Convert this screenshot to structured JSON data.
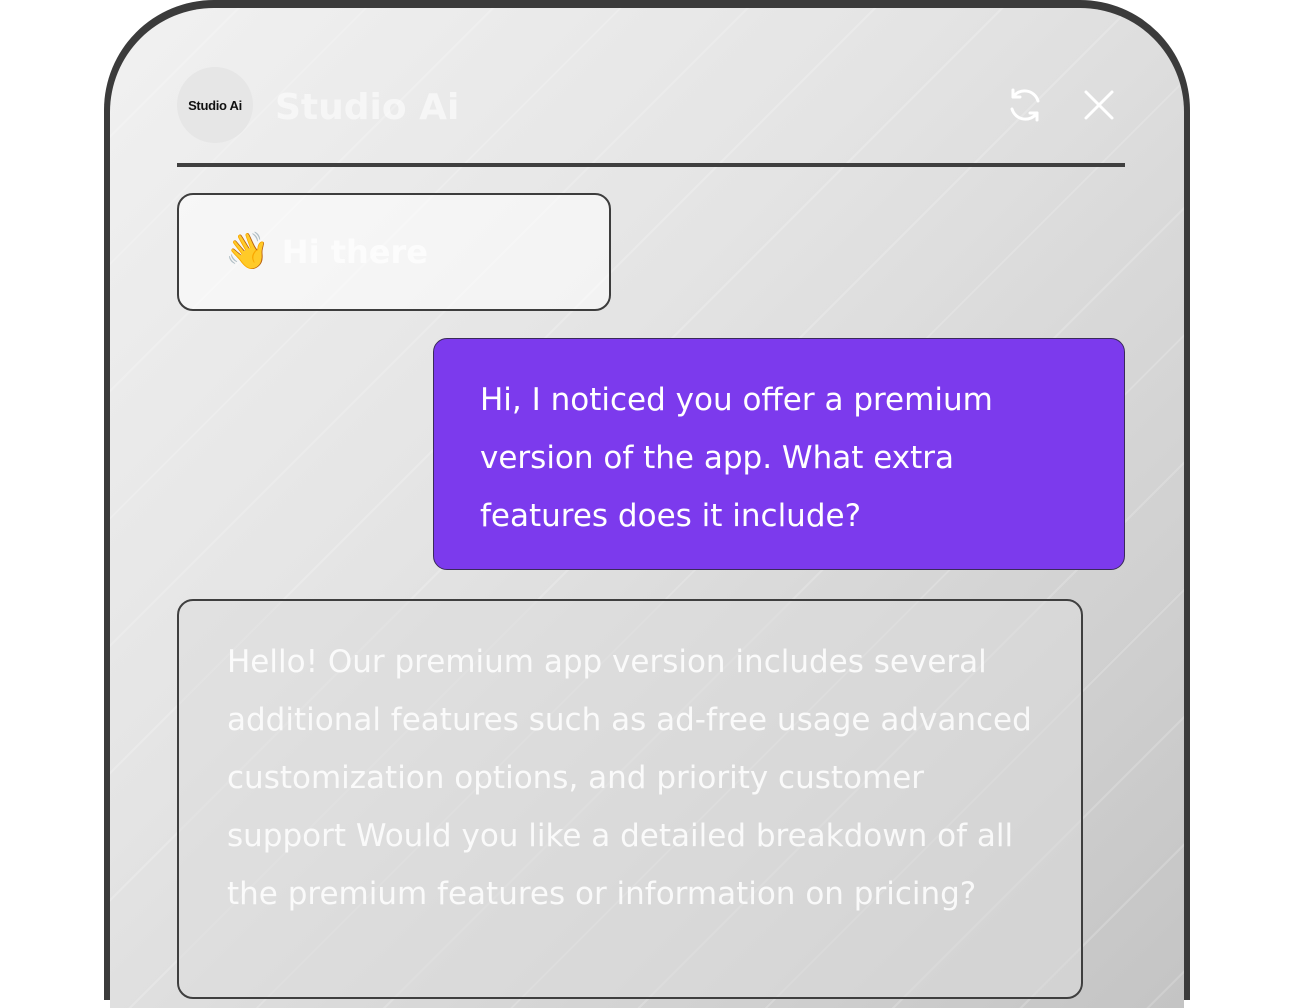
{
  "header": {
    "avatar_text": "Studio Ai",
    "title": "Studio Ai",
    "refresh_icon": "refresh-icon",
    "close_icon": "close-icon"
  },
  "messages": {
    "greeting": {
      "emoji": "👋",
      "text": "Hi there"
    },
    "user": {
      "text": "Hi, I noticed you offer a premium version of the app. What extra features does it include?"
    },
    "bot": {
      "text": "Hello! Our premium app version includes several additional features such as ad-free usage advanced customization options, and priority customer support Would you like a detailed breakdown of all the premium features or information on pricing?"
    }
  },
  "colors": {
    "user_bubble": "#7c3aed",
    "frame": "#3b3b3b",
    "divider": "#3f3f3f"
  }
}
